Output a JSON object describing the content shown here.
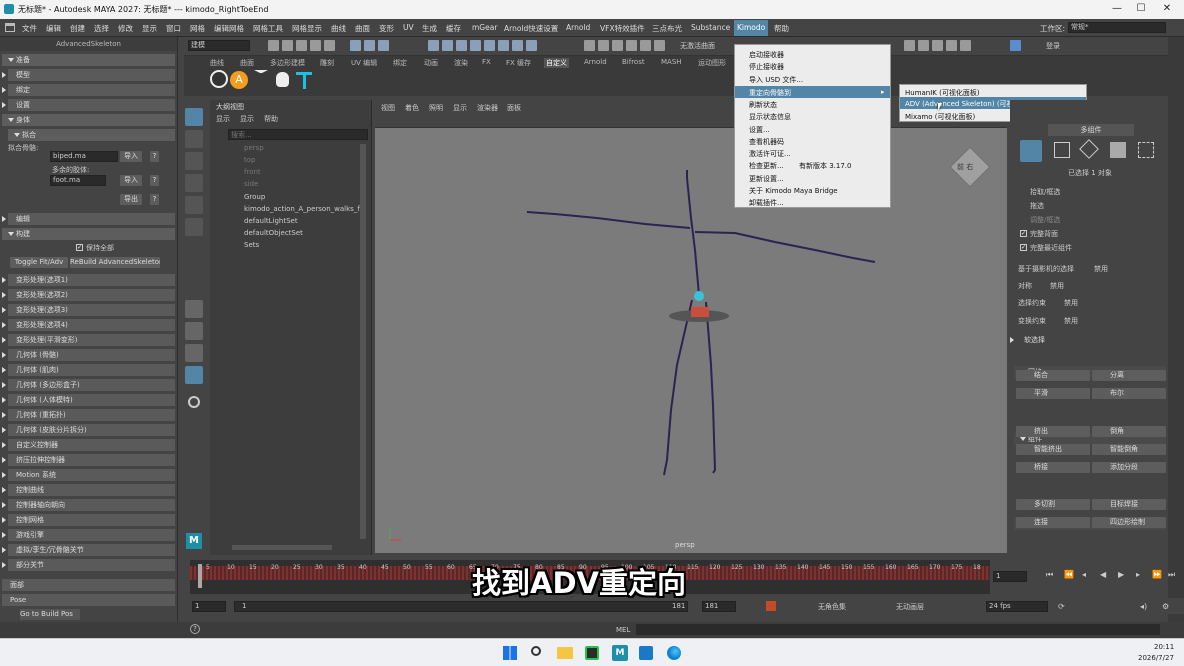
{
  "window": {
    "title": "无标题* - Autodesk MAYA 2027: 无标题*   ---   kimodo_RightToeEnd",
    "minimize": "—",
    "maximize": "☐",
    "close": "✕"
  },
  "menubar": {
    "items": [
      "文件",
      "编辑",
      "创建",
      "选择",
      "修改",
      "显示",
      "窗口",
      "网格",
      "编辑网格",
      "网格工具",
      "网格显示",
      "曲线",
      "曲面",
      "变形",
      "UV",
      "生成",
      "缓存",
      "mGear",
      "Arnold快速设置",
      "Arnold",
      "VFX特效插件",
      "三点布光",
      "Substance",
      "Kimodo",
      "帮助"
    ],
    "active_item": "Kimodo",
    "workspace_label": "工作区:",
    "workspace_value": "常规*"
  },
  "toolbar": {
    "mode_dropdown": "建模",
    "no_live_surface": "无激活曲面",
    "login": "登录"
  },
  "shelf": {
    "tabs": [
      "曲线",
      "曲面",
      "多边形建模",
      "雕刻",
      "UV 编辑",
      "绑定",
      "动画",
      "渲染",
      "FX",
      "FX 缓存",
      "自定义",
      "Arnold",
      "Bifrost",
      "MASH",
      "运动图形"
    ],
    "active_tab": "自定义"
  },
  "left_panel": {
    "title": "AdvancedSkeleton",
    "sections": {
      "prepare": "准备",
      "model": "模型",
      "fit": "绑定",
      "settings": "设置",
      "body": "身体",
      "fit_sub": "拟合",
      "fit_skeleton_label": "拟合骨骼:",
      "fit_skeleton_value": "biped.ma",
      "import_btn": "导入",
      "help_btn": "?",
      "optional_label": "多余的胶体:",
      "foot_value": "foot.ma",
      "import_btn2": "导入",
      "help_btn2": "?",
      "export_btn": "导出",
      "help_btn3": "?",
      "edit": "编辑",
      "build": "构建",
      "keep_all": "保持全部",
      "toggle_fit": "Toggle Fit/Adv",
      "rebuild": "ReBuild AdvancedSkeleton"
    },
    "items": [
      "变形处理(选项1)",
      "变形处理(选项2)",
      "变形处理(选项3)",
      "变形处理(选项4)",
      "变形处理(平滑变形)",
      "几何体 (骨骼)",
      "几何体 (肌肉)",
      "几何体 (多边形盒子)",
      "几何体 (人体模特)",
      "几何体 (重拓扑)",
      "几何体 (皮肤分片拆分)",
      "自定义控制器",
      "挤压拉伸控制器",
      "Motion 系统",
      "控制曲线",
      "控制器轴向朝向",
      "控制网格",
      "游戏引擎",
      "虚拟/孪生/冗骨骼关节",
      "部分关节"
    ],
    "face": "面部",
    "pose": "Pose",
    "bottom_status": "Go to Build Pos"
  },
  "outliner": {
    "title": "大纲视图",
    "menu": [
      "显示",
      "显示",
      "帮助"
    ],
    "search_placeholder": "搜索...",
    "items": [
      "persp",
      "top",
      "front",
      "side",
      "Group",
      "kimodo_action_A_person_walks_f",
      "defaultLightSet",
      "defaultObjectSet",
      "Sets"
    ]
  },
  "viewport": {
    "menu": [
      "视图",
      "着色",
      "照明",
      "显示",
      "渲染器",
      "面板"
    ],
    "camera_label": "persp",
    "viewcube_text": "前 右"
  },
  "kimodo_menu": {
    "items": [
      "启动接收器",
      "停止接收器",
      "导入 USD 文件...",
      "重定向骨骼到",
      "刷新状态",
      "显示状态信息",
      "设置...",
      "查看机器码",
      "激活许可证...",
      "检查更新...",
      "有新版本 3.17.0",
      "更新设置...",
      "关于 Kimodo Maya Bridge",
      "卸载插件..."
    ],
    "highlighted": "重定向骨骼到"
  },
  "submenu": {
    "items": [
      "HumanIK (可视化面板)",
      "ADV (Advanced Skeleton) (可视化面板)",
      "Mixamo (可视化面板)"
    ],
    "highlighted": "ADV (Advanced Skeleton) (可视化面板)"
  },
  "attribute_panel": {
    "header": "多组件",
    "selected": "已选择 1 对象",
    "options": [
      "拾取/框选",
      "拖选",
      "调整/框选"
    ],
    "checks": [
      "完整背面",
      "完整最近组件"
    ],
    "camera_based": "基于摄影机的选择",
    "camera_based_value": "禁用",
    "symmetry": "对称",
    "symmetry_value": "禁用",
    "sel_constraint": "选择约束",
    "sel_constraint_value": "禁用",
    "transform_constraint": "变换约束",
    "transform_constraint_value": "禁用",
    "soft_select": "软选择",
    "mesh_section": "网格",
    "mesh_buttons": [
      "结合",
      "分离",
      "平滑",
      "布尔"
    ],
    "component_section": "组件",
    "component_buttons": [
      "挤出",
      "倒角",
      "智能挤出",
      "智能倒角",
      "桥接",
      "添加分段"
    ],
    "tools_section": "工具",
    "tools_buttons": [
      "多切割",
      "目标焊接",
      "连接",
      "四边形绘制"
    ]
  },
  "timeline": {
    "ticks": [
      "5",
      "10",
      "15",
      "20",
      "25",
      "30",
      "35",
      "40",
      "45",
      "50",
      "55",
      "60",
      "65",
      "70",
      "75",
      "80",
      "85",
      "90",
      "95",
      "100",
      "105",
      "110",
      "115",
      "120",
      "125",
      "130",
      "135",
      "140",
      "145",
      "150",
      "155",
      "160",
      "165",
      "170",
      "175",
      "18"
    ],
    "current_frame": "1"
  },
  "range": {
    "start": "1",
    "inner_start": "1",
    "inner_end": "181",
    "end": "181",
    "character_set": "无角色集",
    "anim_layer": "无动画层",
    "fps": "24 fps"
  },
  "cmdline": {
    "label": "MEL"
  },
  "subtitle": "找到ADV重定向",
  "taskbar": {
    "time": "20:11",
    "date": "2026/7/27"
  }
}
